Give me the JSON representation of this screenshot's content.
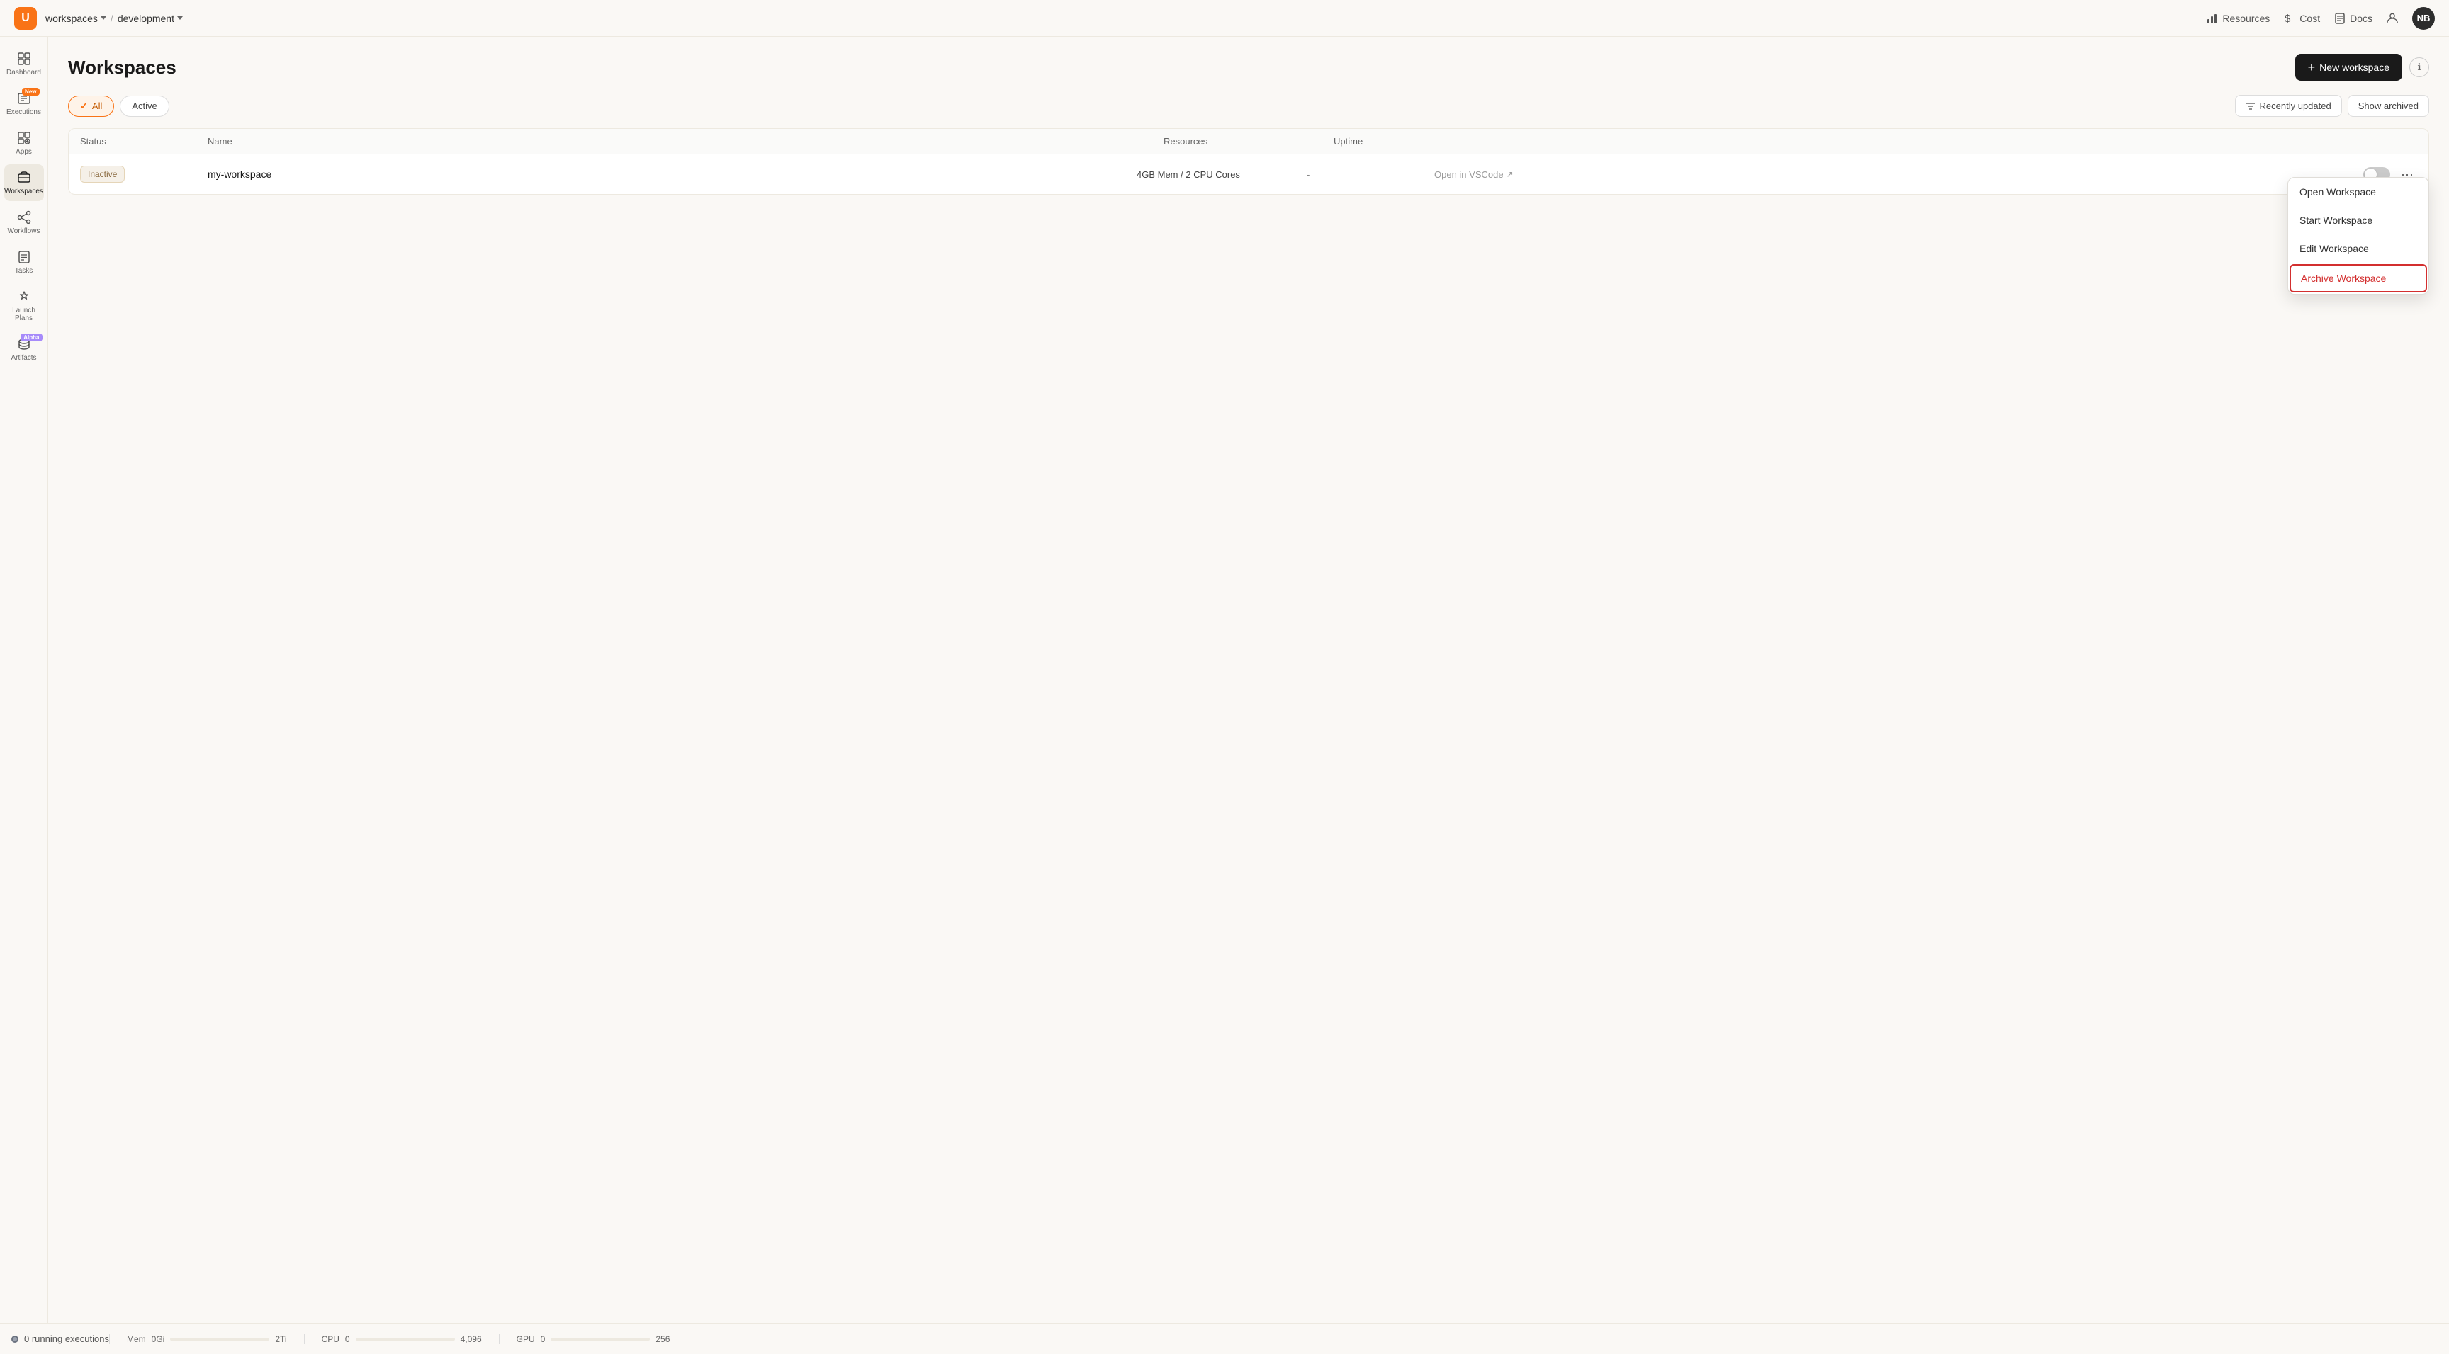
{
  "topnav": {
    "logo": "U",
    "breadcrumb": [
      {
        "label": "workspaces",
        "has_dropdown": true
      },
      {
        "label": "development",
        "has_dropdown": true
      }
    ],
    "nav_links": [
      {
        "label": "Resources",
        "icon": "bar-chart-icon"
      },
      {
        "label": "Cost",
        "icon": "dollar-icon"
      },
      {
        "label": "Docs",
        "icon": "doc-icon"
      }
    ],
    "avatar": "NB"
  },
  "sidebar": {
    "items": [
      {
        "label": "Dashboard",
        "icon": "dashboard-icon",
        "active": false,
        "badge": null
      },
      {
        "label": "Executions",
        "icon": "executions-icon",
        "active": false,
        "badge": "New"
      },
      {
        "label": "Apps",
        "icon": "apps-icon",
        "active": false,
        "badge": null
      },
      {
        "label": "Workspaces",
        "icon": "workspaces-icon",
        "active": true,
        "badge": null
      },
      {
        "label": "Workflows",
        "icon": "workflows-icon",
        "active": false,
        "badge": null
      },
      {
        "label": "Tasks",
        "icon": "tasks-icon",
        "active": false,
        "badge": null
      },
      {
        "label": "Launch Plans",
        "icon": "launchplans-icon",
        "active": false,
        "badge": null
      },
      {
        "label": "Artifacts",
        "icon": "artifacts-icon",
        "active": false,
        "badge": "Alpha"
      }
    ]
  },
  "page": {
    "title": "Workspaces",
    "new_workspace_label": "New workspace",
    "filter_tabs": [
      {
        "label": "All",
        "active": true
      },
      {
        "label": "Active",
        "active": false
      }
    ],
    "sort_label": "Recently updated",
    "archived_label": "Show archived",
    "table": {
      "columns": [
        "Status",
        "Name",
        "Resources",
        "Uptime",
        "",
        ""
      ],
      "rows": [
        {
          "status": "Inactive",
          "name": "my-workspace",
          "resources": "4GB Mem / 2 CPU Cores",
          "uptime": "-",
          "open_vscode": "Open in VSCode",
          "toggle_on": false
        }
      ]
    },
    "context_menu": {
      "items": [
        {
          "label": "Open Workspace",
          "danger": false
        },
        {
          "label": "Start Workspace",
          "danger": false
        },
        {
          "label": "Edit Workspace",
          "danger": false
        },
        {
          "label": "Archive Workspace",
          "danger": true
        }
      ]
    }
  },
  "bottom_bar": {
    "running_executions": "0 running executions",
    "resources": [
      {
        "label": "Mem",
        "min": "0Gi",
        "max": "2Ti",
        "fill_pct": 0
      },
      {
        "label": "CPU",
        "min": "0",
        "max": "4,096",
        "fill_pct": 0
      },
      {
        "label": "GPU",
        "min": "0",
        "max": "256",
        "fill_pct": 0
      }
    ]
  }
}
